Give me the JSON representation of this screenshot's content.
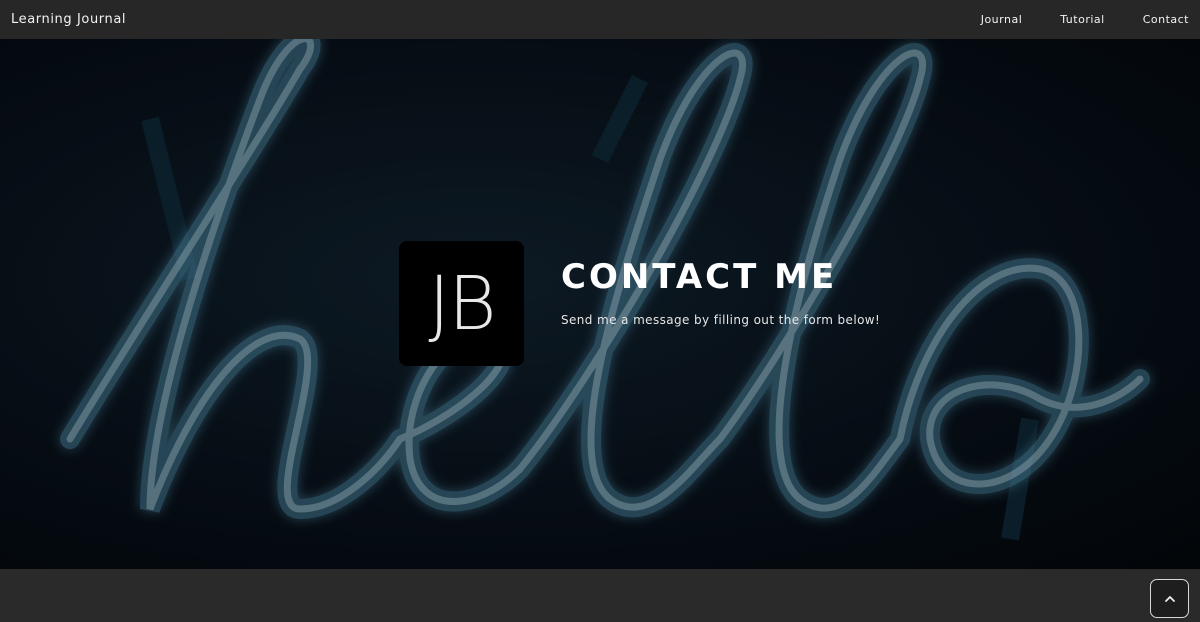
{
  "navbar": {
    "brand": "Learning Journal",
    "links": [
      "Journal",
      "Tutorial",
      "Contact"
    ]
  },
  "hero": {
    "logo_text": "JB",
    "title": "CONTACT ME",
    "subtitle": "Send me a message by filling out the form below!",
    "background_image": "neon hello sign",
    "neon_color": "#5fa9c9"
  },
  "scroll_top": {
    "icon": "chevron-up-icon"
  }
}
